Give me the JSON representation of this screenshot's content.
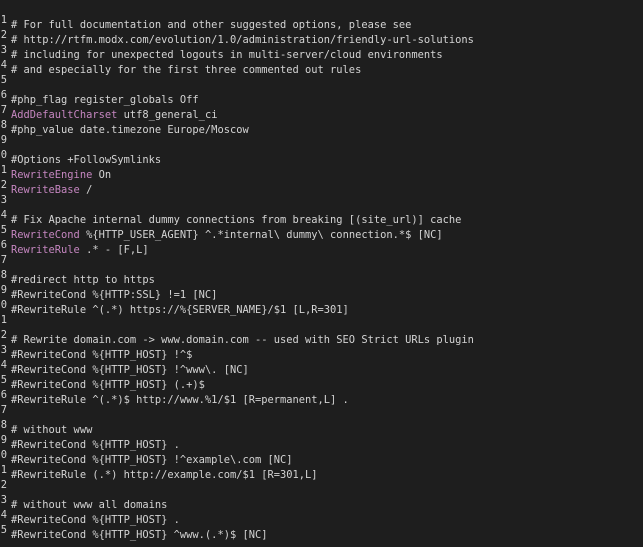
{
  "editor": {
    "lines": [
      {
        "num": "1",
        "tokens": [
          {
            "t": "# For full documentation and other suggested options, please see",
            "c": "comment"
          }
        ]
      },
      {
        "num": "2",
        "tokens": [
          {
            "t": "# http://rtfm.modx.com/evolution/1.0/administration/friendly-url-solutions",
            "c": "comment"
          }
        ]
      },
      {
        "num": "3",
        "tokens": [
          {
            "t": "# including for unexpected logouts in multi-server/cloud environments",
            "c": "comment"
          }
        ]
      },
      {
        "num": "4",
        "tokens": [
          {
            "t": "# and especially for the first three commented out rules",
            "c": "comment"
          }
        ]
      },
      {
        "num": "5",
        "tokens": [
          {
            "t": "",
            "c": "plain"
          }
        ]
      },
      {
        "num": "6",
        "tokens": [
          {
            "t": "#php_flag register_globals Off",
            "c": "comment"
          }
        ]
      },
      {
        "num": "7",
        "tokens": [
          {
            "t": "AddDefaultCharset",
            "c": "keyword"
          },
          {
            "t": " utf8_general_ci",
            "c": "plain"
          }
        ]
      },
      {
        "num": "8",
        "tokens": [
          {
            "t": "#php_value date.timezone Europe/Moscow",
            "c": "comment"
          }
        ]
      },
      {
        "num": "9",
        "tokens": [
          {
            "t": "",
            "c": "plain"
          }
        ]
      },
      {
        "num": "0",
        "tokens": [
          {
            "t": "#Options +FollowSymlinks",
            "c": "comment"
          }
        ]
      },
      {
        "num": "1",
        "tokens": [
          {
            "t": "RewriteEngine",
            "c": "keyword"
          },
          {
            "t": " On",
            "c": "plain"
          }
        ]
      },
      {
        "num": "2",
        "tokens": [
          {
            "t": "RewriteBase",
            "c": "keyword"
          },
          {
            "t": " /",
            "c": "plain"
          }
        ]
      },
      {
        "num": "3",
        "tokens": [
          {
            "t": "",
            "c": "plain"
          }
        ]
      },
      {
        "num": "4",
        "tokens": [
          {
            "t": "# Fix Apache internal dummy connections from breaking [(site_url)] cache",
            "c": "comment"
          }
        ]
      },
      {
        "num": "5",
        "tokens": [
          {
            "t": "RewriteCond",
            "c": "keyword"
          },
          {
            "t": " %{HTTP_USER_AGENT} ^.*internal\\ dummy\\ connection.*$ [NC]",
            "c": "plain"
          }
        ]
      },
      {
        "num": "6",
        "tokens": [
          {
            "t": "RewriteRule",
            "c": "keyword"
          },
          {
            "t": " .* - [F,L]",
            "c": "plain"
          }
        ]
      },
      {
        "num": "7",
        "tokens": [
          {
            "t": "",
            "c": "plain"
          }
        ]
      },
      {
        "num": "8",
        "tokens": [
          {
            "t": "#redirect http to https",
            "c": "comment"
          }
        ]
      },
      {
        "num": "9",
        "tokens": [
          {
            "t": "#RewriteCond %{HTTP:SSL} !=1 [NC]",
            "c": "comment"
          }
        ]
      },
      {
        "num": "0",
        "tokens": [
          {
            "t": "#RewriteRule ^(.*) https://%{SERVER_NAME}/$1 [L,R=301]",
            "c": "comment"
          }
        ]
      },
      {
        "num": "1",
        "tokens": [
          {
            "t": "",
            "c": "plain"
          }
        ]
      },
      {
        "num": "2",
        "tokens": [
          {
            "t": "# Rewrite domain.com -> www.domain.com -- used with SEO Strict URLs plugin",
            "c": "comment"
          }
        ]
      },
      {
        "num": "3",
        "tokens": [
          {
            "t": "#RewriteCond %{HTTP_HOST} !^$",
            "c": "comment"
          }
        ]
      },
      {
        "num": "4",
        "tokens": [
          {
            "t": "#RewriteCond %{HTTP_HOST} !^www\\. [NC]",
            "c": "comment"
          }
        ]
      },
      {
        "num": "5",
        "tokens": [
          {
            "t": "#RewriteCond %{HTTP_HOST} (.+)$",
            "c": "comment"
          }
        ]
      },
      {
        "num": "6",
        "tokens": [
          {
            "t": "#RewriteRule ^(.*)$ http://www.%1/$1 [R=permanent,L] .",
            "c": "comment"
          }
        ]
      },
      {
        "num": "7",
        "tokens": [
          {
            "t": "",
            "c": "plain"
          }
        ]
      },
      {
        "num": "8",
        "tokens": [
          {
            "t": "# without www",
            "c": "comment"
          }
        ]
      },
      {
        "num": "9",
        "tokens": [
          {
            "t": "#RewriteCond %{HTTP_HOST} .",
            "c": "comment"
          }
        ]
      },
      {
        "num": "0",
        "tokens": [
          {
            "t": "#RewriteCond %{HTTP_HOST} !^example\\.com [NC]",
            "c": "comment"
          }
        ]
      },
      {
        "num": "1",
        "tokens": [
          {
            "t": "#RewriteRule (.*) http://example.com/$1 [R=301,L]",
            "c": "comment"
          }
        ]
      },
      {
        "num": "2",
        "tokens": [
          {
            "t": "",
            "c": "plain"
          }
        ]
      },
      {
        "num": "3",
        "tokens": [
          {
            "t": "# without www all domains",
            "c": "comment"
          }
        ]
      },
      {
        "num": "4",
        "tokens": [
          {
            "t": "#RewriteCond %{HTTP_HOST} .",
            "c": "comment"
          }
        ]
      },
      {
        "num": "5",
        "tokens": [
          {
            "t": "#RewriteCond %{HTTP_HOST} ^www.(.*)$ [NC]",
            "c": "comment"
          }
        ]
      }
    ]
  },
  "colors": {
    "background": "#1e1e1e",
    "text": "#d4d4d4",
    "keyword": "#c586c0"
  }
}
